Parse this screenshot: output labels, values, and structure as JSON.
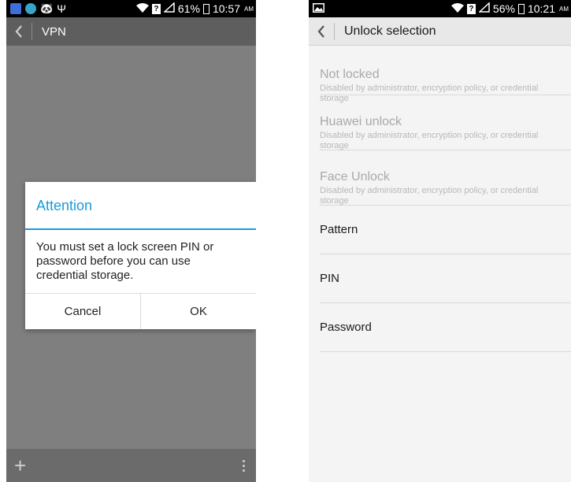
{
  "left": {
    "status": {
      "battery_percent": "61%",
      "time": "10:57",
      "ampm": "AM",
      "icons": [
        "notification-app-icon",
        "globe-app-icon",
        "android-icon",
        "usb-icon",
        "wifi-icon",
        "sim-alert-icon",
        "signal-icon",
        "battery-icon"
      ]
    },
    "actionbar": {
      "title": "VPN"
    },
    "dialog": {
      "title": "Attention",
      "message": "You must set a lock screen PIN or password before you can use credential storage.",
      "cancel_label": "Cancel",
      "ok_label": "OK"
    },
    "bottombar": {
      "add_glyph": "+"
    }
  },
  "right": {
    "status": {
      "battery_percent": "56%",
      "time": "10:21",
      "ampm": "AM",
      "icons": [
        "image-icon",
        "wifi-icon",
        "sim-alert-icon",
        "signal-icon",
        "battery-icon"
      ]
    },
    "actionbar": {
      "title": "Unlock selection"
    },
    "items": [
      {
        "title": "Not locked",
        "subtitle": "Disabled by administrator, encryption policy, or credential storage"
      },
      {
        "title": "Huawei unlock",
        "subtitle": "Disabled by administrator, encryption policy, or credential storage"
      },
      {
        "title": "Face Unlock",
        "subtitle": "Disabled by administrator, encryption policy, or credential storage"
      },
      {
        "title": "Pattern"
      },
      {
        "title": "PIN"
      },
      {
        "title": "Password"
      }
    ]
  },
  "colors": {
    "accent": "#1a9bd7",
    "dim_overlay": "#7f7f7f",
    "disabled_text": "#a9a9a9"
  }
}
